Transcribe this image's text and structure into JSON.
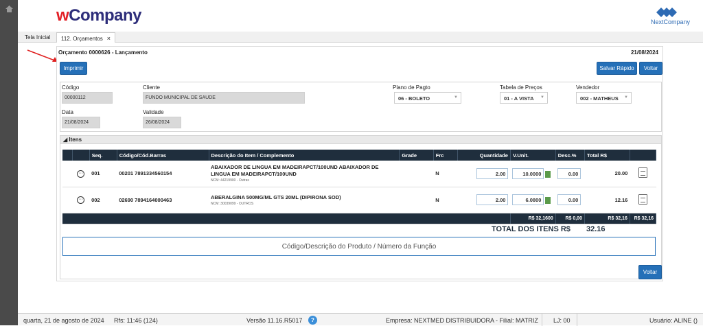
{
  "app": {
    "logo_w": "w",
    "logo_company": "Company",
    "brand_text": "NextCompany"
  },
  "tabs": [
    {
      "label": "Tela Inicial"
    },
    {
      "label": "112. Orçamentos",
      "close": "×"
    }
  ],
  "card": {
    "title": "Orçamento 0000626 - Lançamento",
    "date": "21/08/2024",
    "print_label": "Imprimir",
    "quick_save_label": "Salvar Rápido",
    "back_label": "Voltar"
  },
  "form": {
    "codigo_label": "Código",
    "codigo_value": "00000112",
    "cliente_label": "Cliente",
    "cliente_value": "FUNDO MUNICIPAL DE SAUDE",
    "plano_label": "Plano de Pagto",
    "plano_value": "06 - BOLETO",
    "tabela_label": "Tabela de Preços",
    "tabela_value": "01 - A VISTA",
    "vendedor_label": "Vendedor",
    "vendedor_value": "002 - MATHEUS",
    "data_label": "Data",
    "data_value": "21/08/2024",
    "validade_label": "Validade",
    "validade_value": "26/08/2024"
  },
  "items": {
    "section_label": "Itens",
    "columns": [
      "Seq.",
      "Código/Cód.Barras",
      "Descrição do Item / Complemento",
      "Grade",
      "Frc",
      "Quantidade",
      "V.Unit.",
      "Desc.%",
      "Total R$"
    ],
    "rows": [
      {
        "seq": "001",
        "code": "00201 7891334560154",
        "desc": "ABAIXADOR DE LINGUA EM MADEIRAPCT/100UND ABAIXADOR DE LINGUA EM MADEIRAPCT/100UND",
        "ncm": "NCM: 44219900 - Outras",
        "frc": "N",
        "qty": "2.00",
        "unit": "10.0000",
        "disc": "0.00",
        "total": "20.00"
      },
      {
        "seq": "002",
        "code": "02690 7894164000463",
        "desc": "ABERALGINA 500MG/ML GTS 20ML (DIPIRONA SOD)",
        "ncm": "NCM: 30039099 - OUTROS",
        "frc": "N",
        "qty": "2.00",
        "unit": "6.0800",
        "disc": "0.00",
        "total": "12.16"
      }
    ],
    "footer": {
      "unit_sum": "R$ 32,1600",
      "disc_sum": "R$ 0,00",
      "total_sum": "R$ 32,16",
      "total_sum2": "R$ 32,16"
    },
    "total_label": "TOTAL DOS ITENS R$",
    "total_value": "32.16",
    "search_placeholder": "Código/Descrição do Produto / Número da Função"
  },
  "footer_back_label": "Voltar",
  "statusbar": {
    "datetime": "quarta, 21 de agosto de 2024",
    "rfs": "Rfs: 11:46 (124)",
    "version": "Versão 11.16.R5017",
    "help": "?",
    "company": "Empresa: NEXTMED DISTRIBUIDORA - Filial: MATRIZ",
    "lj": "LJ: 00",
    "user": "Usuário: ALINE ()"
  },
  "colors": {
    "accent": "#2570b8",
    "header_dark": "#1f2e3d",
    "logo_red": "#e21f26",
    "logo_navy": "#2e2e7a"
  },
  "icons": [
    "home-icon",
    "nextcompany-logo-icon",
    "close-icon",
    "collapse-icon",
    "options-icon",
    "calculator-icon",
    "document-icon",
    "help-icon",
    "annotation-arrow"
  ]
}
